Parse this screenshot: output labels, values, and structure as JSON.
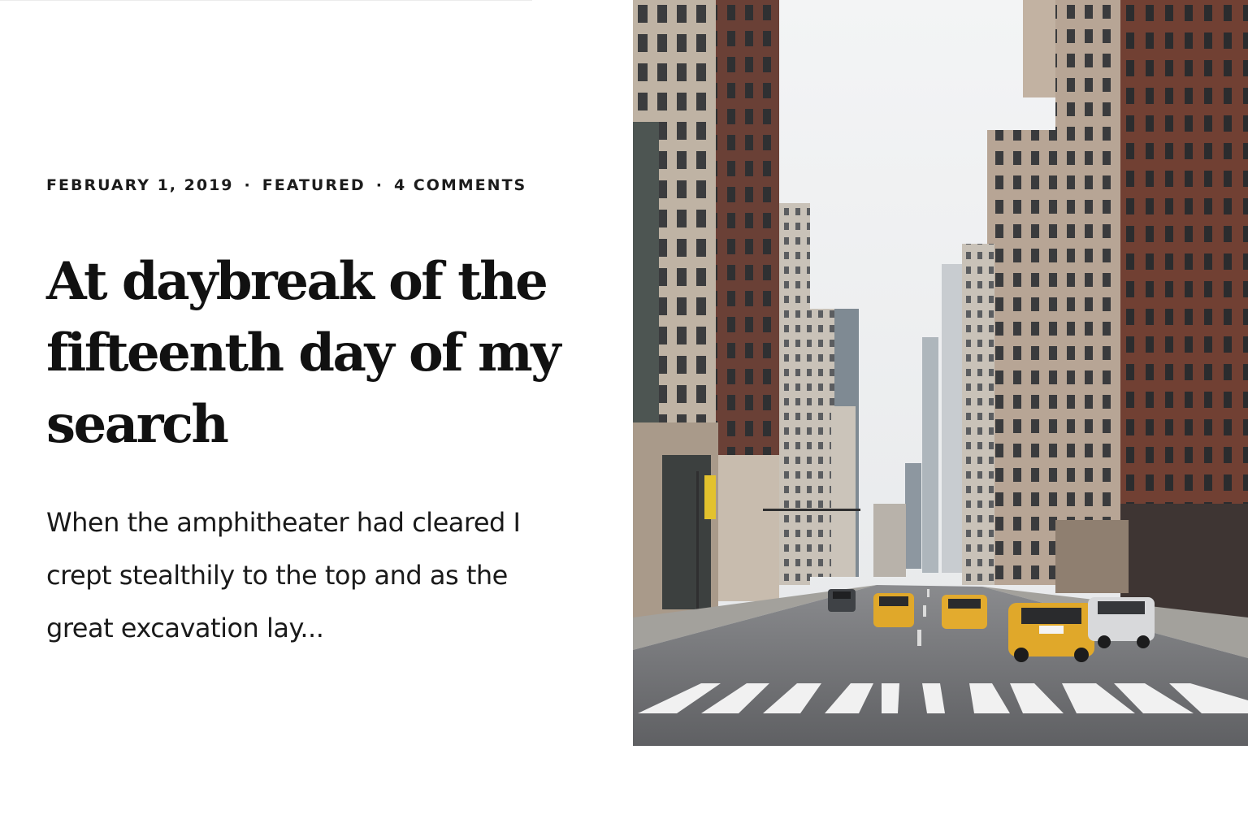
{
  "post": {
    "meta": {
      "date": "FEBRUARY 1, 2019",
      "separator": "·",
      "category": "FEATURED",
      "comments": "4 COMMENTS"
    },
    "title": "At daybreak of the fifteenth day of my search",
    "excerpt": "When the amphitheater had cleared I crept stealthily to the top and as the great excavation lay..."
  },
  "featured_image": {
    "subject": "city-street-photo",
    "colors": {
      "sky": "#eef0f2",
      "road": "#6d6e71",
      "taxi": "#e0a82a",
      "brick": "#6a4036",
      "stone": "#b9ab9b"
    }
  }
}
